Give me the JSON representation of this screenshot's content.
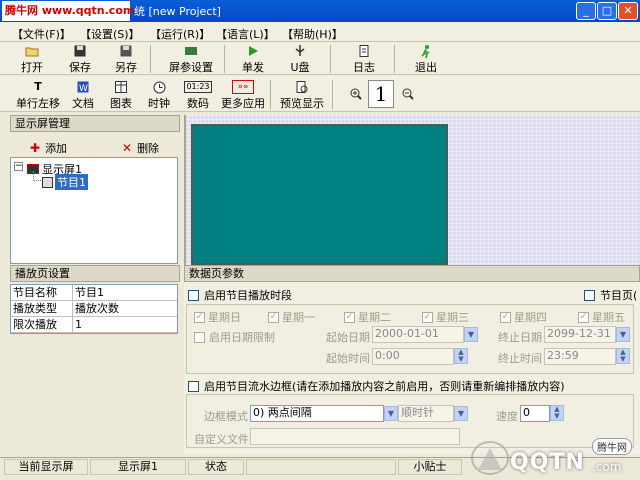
{
  "watermark": {
    "site": "腾牛网 www.qqtn.com",
    "logo_text": "QQTN",
    "logo_sub": ".com",
    "logo_badge": "腾牛网"
  },
  "window": {
    "title": "统 [new Project]"
  },
  "menu": [
    "【文件(F)】",
    "【设置(S)】",
    "【运行(R)】",
    "【语言(L)】",
    "【帮助(H)】"
  ],
  "toolbar1": {
    "open": "打开",
    "save": "保存",
    "save_as": "另存",
    "screen_settings": "屏参设置",
    "send": "单发",
    "usb": "U盘",
    "log": "日志",
    "exit": "退出"
  },
  "toolbar2": {
    "scroll_left": "单行左移",
    "document": "文档",
    "picture": "图表",
    "clock": "时钟",
    "digital": "数码",
    "more_apps": "更多应用",
    "preview": "预览显示",
    "zoom_value": "1",
    "clock_digits": "01:23"
  },
  "screen_mgmt": {
    "header": "显示屏管理",
    "add": "添加",
    "delete": "删除",
    "tree": {
      "screen": "显示屏1",
      "program": "节目1"
    }
  },
  "page_settings": {
    "header": "播放页设置",
    "rows": [
      {
        "key": "节目名称",
        "value": "节目1"
      },
      {
        "key": "播放类型",
        "value": "播放次数"
      },
      {
        "key": "限次播放",
        "value": "1"
      }
    ]
  },
  "page_params": {
    "header": "数据页参数",
    "enable_time": "启用节目播放时段",
    "program_page": "节目页(",
    "weekdays": [
      "星期日",
      "星期一",
      "星期二",
      "星期三",
      "星期四",
      "星期五"
    ],
    "enable_date": "启用日期限制",
    "start_date_label": "起始日期",
    "start_date": "2000-01-01",
    "end_date_label": "终止日期",
    "end_date": "2099-12-31",
    "start_time_label": "起始时间",
    "start_time": "0:00",
    "end_time_label": "终止时间",
    "end_time": "23:59",
    "enable_border": "启用节目流水边框(请在添加播放内容之前启用，否则请重新编排播放内容)",
    "border_mode_label": "边框模式",
    "border_mode": "0) 两点间隔",
    "direction": "顺时针",
    "speed_label": "速度",
    "speed": "0",
    "custom_file_label": "自定义文件"
  },
  "status": {
    "current_screen_label": "当前显示屏",
    "current_screen": "显示屏1",
    "state_label": "状态",
    "tip_label": "小贴士"
  },
  "colors": {
    "preview_screen": "#007f80",
    "titlebar": "#0a5fd8"
  }
}
